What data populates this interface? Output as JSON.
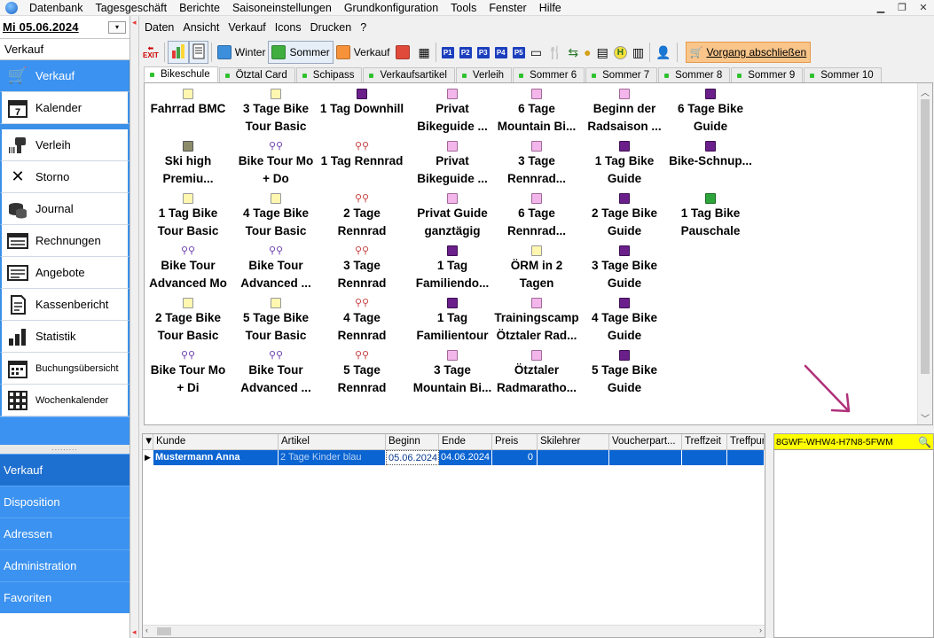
{
  "menu": [
    "Datenbank",
    "Tagesgeschäft",
    "Berichte",
    "Saisoneinstellungen",
    "Grundkonfiguration",
    "Tools",
    "Fenster",
    "Hilfe"
  ],
  "window_controls": [
    "▁",
    "❐",
    "✕"
  ],
  "date": "Mi 05.06.2024",
  "module_title": "Verkauf",
  "nav": [
    {
      "label": "Verkauf",
      "icon": "shopping-cart-icon"
    },
    {
      "label": "Kalender",
      "icon": "calendar-icon"
    },
    {
      "label": "Verleih",
      "icon": "scanner-icon"
    },
    {
      "label": "Storno",
      "icon": "x-icon"
    },
    {
      "label": "Journal",
      "icon": "coins-icon"
    },
    {
      "label": "Rechnungen",
      "icon": "invoice-icon"
    },
    {
      "label": "Angebote",
      "icon": "offer-icon"
    },
    {
      "label": "Kassenbericht",
      "icon": "report-icon"
    },
    {
      "label": "Statistik",
      "icon": "chart-icon"
    },
    {
      "label": "Buchungsübersicht",
      "icon": "booking-calendar-icon"
    },
    {
      "label": "Wochenkalender",
      "icon": "week-grid-icon"
    }
  ],
  "bottom_nav": [
    "Verkauf",
    "Disposition",
    "Adressen",
    "Administration",
    "Favoriten"
  ],
  "submenu": [
    "Daten",
    "Ansicht",
    "Verkauf",
    "Icons",
    "Drucken",
    "?"
  ],
  "toolbar": {
    "winter": "Winter",
    "sommer": "Sommer",
    "verkauf": "Verkauf",
    "p_buttons": [
      "P1",
      "P2",
      "P3",
      "P4",
      "P5"
    ],
    "abschluss": "Vorgang abschließen"
  },
  "tabs": [
    "Bikeschule",
    "Ötztal Card",
    "Schipass",
    "Verkaufsartikel",
    "Verleih",
    "Sommer 6",
    "Sommer 7",
    "Sommer 8",
    "Sommer 9",
    "Sommer 10"
  ],
  "articles": [
    [
      "Fahrrad BMC",
      "3 Tage Bike\nTour Basic",
      "1 Tag Downhill",
      "Privat\nBikeguide ...",
      "6 Tage\nMountain Bi...",
      "Beginn der\nRadsaison ...",
      "6 Tage Bike\nGuide"
    ],
    [
      "Ski high\nPremiu...",
      "Bike Tour Mo\n+ Do",
      "1 Tag Rennrad",
      "Privat\nBikeguide ...",
      "3 Tage\nRennrad...",
      "1 Tag Bike\nGuide",
      "Bike-Schnup..."
    ],
    [
      "1 Tag Bike\nTour Basic",
      "4 Tage Bike\nTour Basic",
      "2 Tage\nRennrad",
      "Privat Guide\nganztägig",
      "6 Tage\nRennrad...",
      "2 Tage Bike\nGuide",
      "1 Tag Bike\nPauschale"
    ],
    [
      "Bike Tour\nAdvanced Mo",
      "Bike Tour\nAdvanced ...",
      "3 Tage\nRennrad",
      "1 Tag\nFamiliendo...",
      "ÖRM in 2\nTagen",
      "3 Tage Bike\nGuide",
      ""
    ],
    [
      "2 Tage Bike\nTour Basic",
      "5 Tage Bike\nTour Basic",
      "4 Tage\nRennrad",
      "1 Tag\nFamilientour",
      "Trainingscamp\nÖtztaler Rad...",
      "4 Tage Bike\nGuide",
      ""
    ],
    [
      "Bike Tour Mo\n+ Di",
      "Bike Tour\nAdvanced ...",
      "5 Tage\nRennrad",
      "3 Tage\nMountain Bi...",
      "Ötztaler\nRadmaratho...",
      "5 Tage Bike\nGuide",
      ""
    ]
  ],
  "table": {
    "columns": [
      "Kunde",
      "Artikel",
      "Beginn",
      "Ende",
      "Preis",
      "Skilehrer",
      "Voucherpart...",
      "Treffzeit",
      "Treffpur"
    ],
    "row": {
      "kunde": "Mustermann Anna",
      "artikel": "2 Tage Kinder blau",
      "beginn": "05.06.2024",
      "ende": "04.06.2024",
      "preis": "0"
    }
  },
  "voucher_code": "8GWF-WHW4-H7N8-5FWM",
  "colors": {
    "nav_blue": "#3b92f0",
    "selection": "#0a64d2",
    "voucher_bg": "#ffff00",
    "arrow": "#b0307a"
  }
}
